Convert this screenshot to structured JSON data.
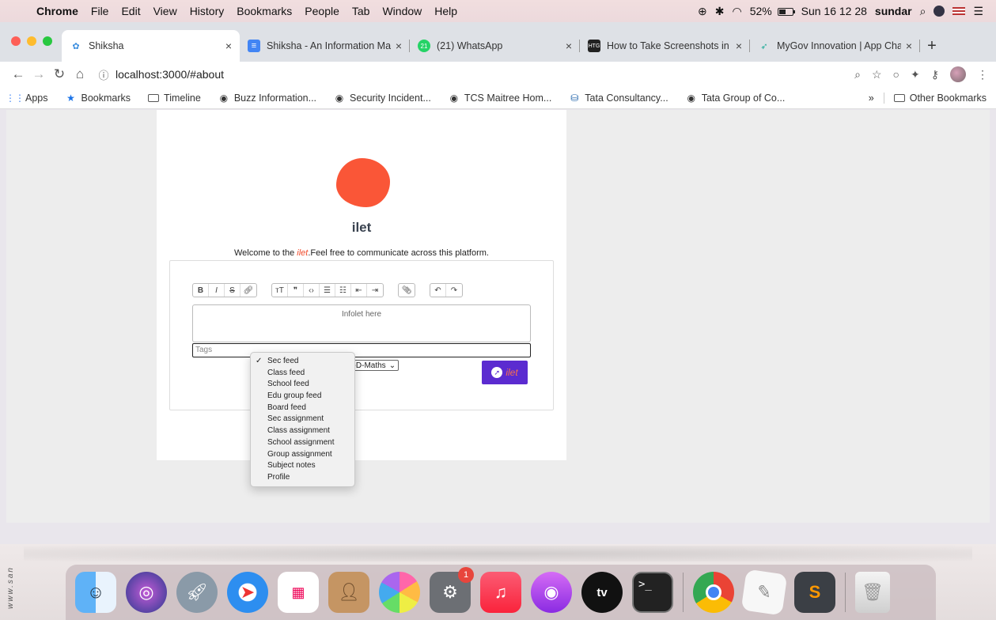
{
  "menubar": {
    "app": "Chrome",
    "items": [
      "File",
      "Edit",
      "View",
      "History",
      "Bookmarks",
      "People",
      "Tab",
      "Window",
      "Help"
    ],
    "battery_percent": "52%",
    "battery_level": 0.52,
    "datetime": "Sun 16 12 28",
    "user": "sundar"
  },
  "tabs": [
    {
      "title": "Shiksha",
      "active": true
    },
    {
      "title": "Shiksha - An Information Ma",
      "active": false
    },
    {
      "title": "(21) WhatsApp",
      "active": false,
      "badge": "21"
    },
    {
      "title": "How to Take Screenshots in",
      "active": false,
      "badge": "HTG"
    },
    {
      "title": "MyGov Innovation | App Cha",
      "active": false
    }
  ],
  "toolbar": {
    "url": "localhost:3000/#about"
  },
  "bookmarks": {
    "items": [
      {
        "label": "Apps",
        "icon": "apps-grid-icon"
      },
      {
        "label": "Bookmarks",
        "icon": "star-icon"
      },
      {
        "label": "Timeline",
        "icon": "folder-icon"
      },
      {
        "label": "Buzz Information...",
        "icon": "globe-icon"
      },
      {
        "label": "Security Incident...",
        "icon": "globe-icon"
      },
      {
        "label": "TCS Maitree Hom...",
        "icon": "globe-icon"
      },
      {
        "label": "Tata Consultancy...",
        "icon": "tata-icon"
      },
      {
        "label": "Tata Group of Co...",
        "icon": "globe-icon"
      }
    ],
    "overflow": "»",
    "other": "Other Bookmarks"
  },
  "page": {
    "brand": "ilet",
    "welcome_prefix": "Welcome to the ",
    "welcome_brand": "ilet",
    "welcome_suffix": ".Feel free to communicate across this platform.",
    "editor_placeholder": "Infolet here",
    "tags_placeholder": "Tags",
    "subject_value": "8-D-Maths",
    "post_label": "ilet",
    "logo_color": "#fa5637",
    "button_color": "#5b2bd0"
  },
  "dropdown": {
    "selected": "Sec feed",
    "options": [
      "Sec feed",
      "Class feed",
      "School feed",
      "Edu group feed",
      "Board feed",
      "Sec assignment",
      "Class assignment",
      "School assignment",
      "Group assignment",
      "Subject notes",
      "Profile"
    ]
  },
  "dock": {
    "side_text": "www.san",
    "badge_count": "1",
    "tv_label": "tv"
  }
}
